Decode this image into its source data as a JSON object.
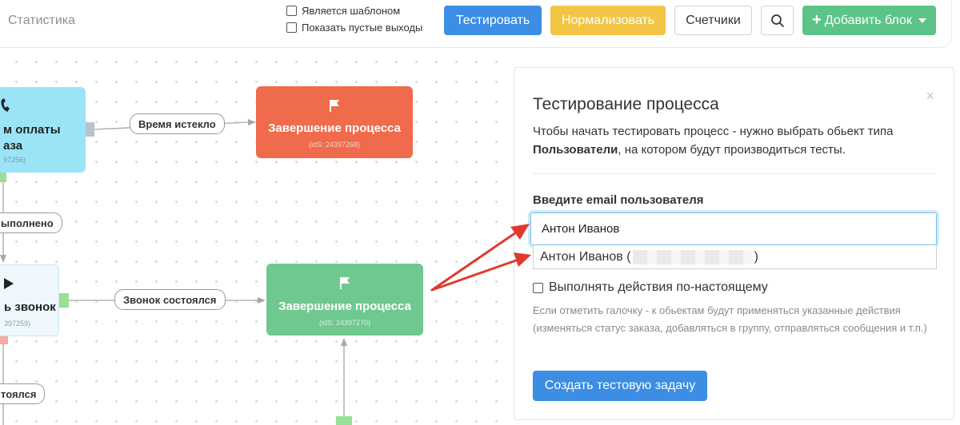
{
  "toolbar": {
    "title": "Статистика",
    "template_label": "Является шаблоном",
    "empty_outputs_label": "Показать пустые выходы",
    "test_button": "Тестировать",
    "normalize_button": "Нормализовать",
    "counters_button": "Счетчики",
    "add_block_button": "Добавить блок",
    "colors": {
      "test": "#3b8ee3",
      "normalize": "#f2c545",
      "add": "#5cc489"
    }
  },
  "canvas": {
    "nodes": {
      "blue": {
        "title_line1": "м оплаты",
        "title_line2": "аза",
        "id": "97256)"
      },
      "red": {
        "title": "Завершение процесса",
        "id": "(idS: 24397268)",
        "icon": "flag-icon"
      },
      "light": {
        "title": "ь звонок",
        "id": "397259)",
        "icon": "play-icon"
      },
      "green": {
        "title": "Завершение процесса",
        "id": "(idS: 24397270)",
        "icon": "flag-icon"
      }
    },
    "edges": {
      "timeout": "Время истекло",
      "done": "ыполнено",
      "call": "Звонок состоялся",
      "call_partial": "тоялся"
    }
  },
  "modal": {
    "title": "Тестирование процесса",
    "desc_part1": "Чтобы начать тестировать процесс - нужно выбрать обьект типа ",
    "desc_bold": "Пользователи",
    "desc_part2": ", на котором будут производиться тесты.",
    "field_label": "Введите email пользователя",
    "email_value": "Антон Иванов",
    "suggestion_name": "Антон Иванов (",
    "suggestion_end": ")",
    "real_actions_label": "Выполнять действия по-настоящему",
    "hint": "Если отметить галочку - к обьектам будут применяться указанные действия (изменяться статус заказа, добавляться в группу, отправляться сообщения и т.п.)",
    "create_button": "Создать тестовую задачу",
    "close_glyph": "×"
  }
}
